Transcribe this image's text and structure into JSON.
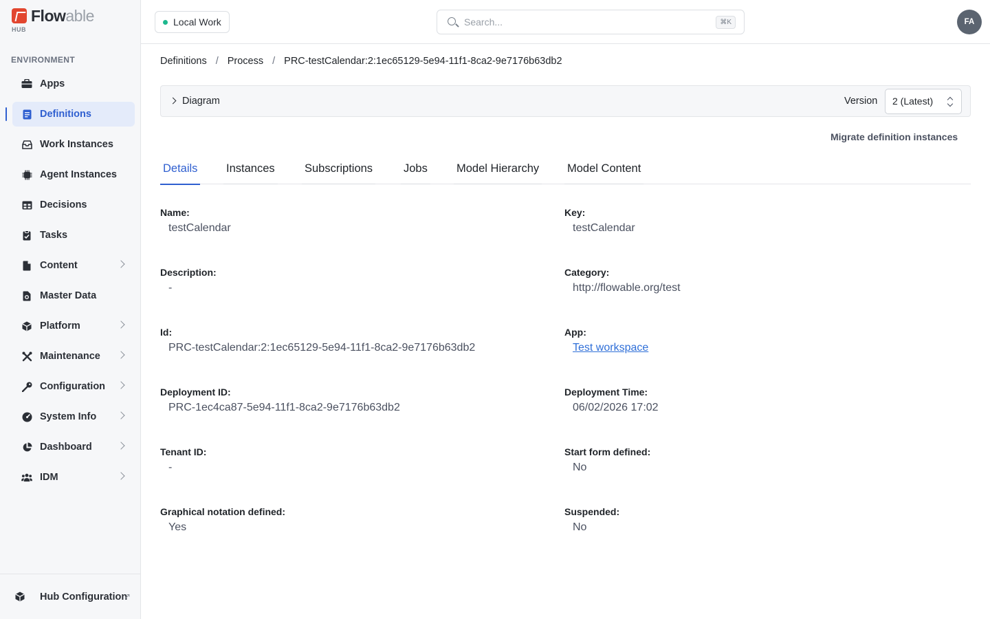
{
  "app": {
    "logo_main": "Flow",
    "logo_lite": "able",
    "logo_sub": "HUB"
  },
  "sidebar": {
    "section_label": "ENVIRONMENT",
    "items": [
      {
        "label": "Apps",
        "icon": "briefcase-icon"
      },
      {
        "label": "Definitions",
        "icon": "document-icon"
      },
      {
        "label": "Work Instances",
        "icon": "inbox-icon"
      },
      {
        "label": "Agent Instances",
        "icon": "cpu-icon"
      },
      {
        "label": "Decisions",
        "icon": "table-icon"
      },
      {
        "label": "Tasks",
        "icon": "clipboard-icon"
      },
      {
        "label": "Content",
        "icon": "file-icon"
      },
      {
        "label": "Master Data",
        "icon": "database-file-icon"
      },
      {
        "label": "Platform",
        "icon": "cube-icon"
      },
      {
        "label": "Maintenance",
        "icon": "tools-icon"
      },
      {
        "label": "Configuration",
        "icon": "key-icon"
      },
      {
        "label": "System Info",
        "icon": "gauge-icon"
      },
      {
        "label": "Dashboard",
        "icon": "pie-chart-icon"
      },
      {
        "label": "IDM",
        "icon": "users-icon"
      }
    ],
    "footer_label": "Hub Configuration"
  },
  "topbar": {
    "workspace": "Local Work",
    "search_placeholder": "Search...",
    "shortcut": "⌘K",
    "avatar": "FA"
  },
  "breadcrumb": {
    "items": [
      "Definitions",
      "Process",
      "PRC-testCalendar:2:1ec65129-5e94-11f1-8ca2-9e7176b63db2"
    ],
    "separator": "/"
  },
  "diagram": {
    "label": "Diagram",
    "version_label": "Version",
    "version_value": "2 (Latest)"
  },
  "actions": {
    "migrate": "Migrate definition instances"
  },
  "tabs": [
    "Details",
    "Instances",
    "Subscriptions",
    "Jobs",
    "Model Hierarchy",
    "Model Content"
  ],
  "details": {
    "name_label": "Name:",
    "name": "testCalendar",
    "key_label": "Key:",
    "key": "testCalendar",
    "description_label": "Description:",
    "description": "-",
    "category_label": "Category:",
    "category": "http://flowable.org/test",
    "id_label": "Id:",
    "id": "PRC-testCalendar:2:1ec65129-5e94-11f1-8ca2-9e7176b63db2",
    "app_label": "App:",
    "app": "Test workspace",
    "deployment_id_label": "Deployment ID:",
    "deployment_id": "PRC-1ec4ca87-5e94-11f1-8ca2-9e7176b63db2",
    "deployment_time_label": "Deployment Time:",
    "deployment_time": "06/02/2026 17:02",
    "tenant_id_label": "Tenant ID:",
    "tenant_id": "-",
    "start_form_label": "Start form defined:",
    "start_form": "No",
    "graphical_label": "Graphical notation defined:",
    "graphical": "Yes",
    "suspended_label": "Suspended:",
    "suspended": "No"
  }
}
